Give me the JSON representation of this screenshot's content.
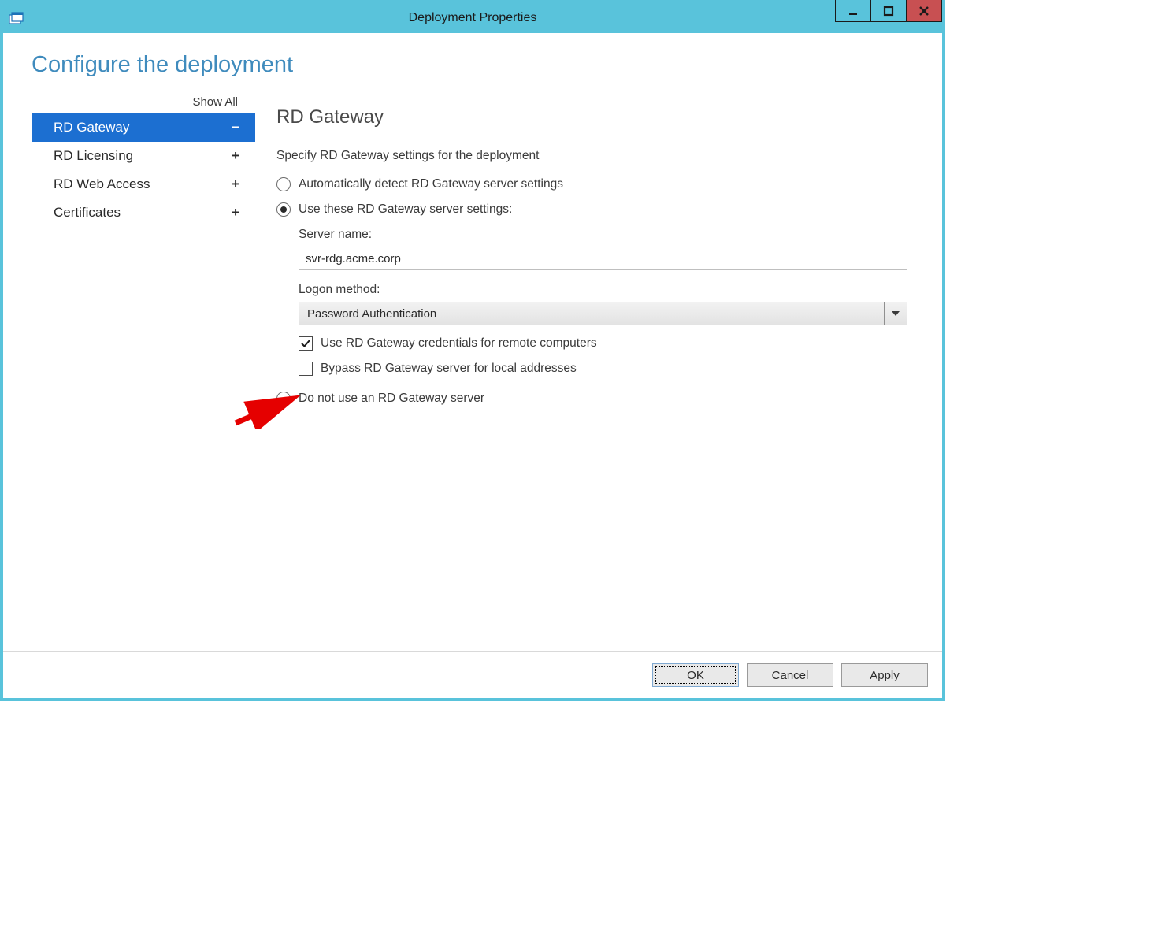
{
  "window": {
    "title": "Deployment Properties"
  },
  "header": {
    "title": "Configure the deployment"
  },
  "sidebar": {
    "show_all": "Show All",
    "items": [
      {
        "label": "RD Gateway",
        "expander": "−",
        "selected": true
      },
      {
        "label": "RD Licensing",
        "expander": "+",
        "selected": false
      },
      {
        "label": "RD Web Access",
        "expander": "+",
        "selected": false
      },
      {
        "label": "Certificates",
        "expander": "+",
        "selected": false
      }
    ]
  },
  "main": {
    "title": "RD Gateway",
    "instruction": "Specify RD Gateway settings for the deployment",
    "options": {
      "auto_detect": "Automatically detect RD Gateway server settings",
      "use_these": "Use these RD Gateway server settings:",
      "do_not_use": "Do not use an RD Gateway server"
    },
    "server_name_label": "Server name:",
    "server_name_value": "svr-rdg.acme.corp",
    "logon_method_label": "Logon method:",
    "logon_method_value": "Password Authentication",
    "checkbox_use_creds": "Use RD Gateway credentials for remote computers",
    "checkbox_bypass": "Bypass RD Gateway server for local addresses"
  },
  "footer": {
    "ok": "OK",
    "cancel": "Cancel",
    "apply": "Apply"
  }
}
